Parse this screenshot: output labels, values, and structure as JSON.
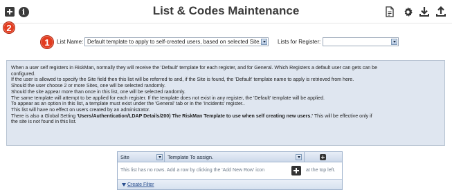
{
  "header": {
    "title": "List & Codes Maintenance",
    "icons": [
      "plus-square-icon",
      "info-icon",
      "document-icon",
      "gear-icon",
      "download-icon",
      "upload-icon"
    ]
  },
  "badges": {
    "one": "1",
    "two": "2"
  },
  "list_selector": {
    "list_name_label": "List Name:",
    "list_name_value": "Default template to apply to self-created users, based on selected Site.",
    "lists_for_register_label": "Lists for Register:",
    "lists_for_register_value": ""
  },
  "info": {
    "lines": [
      "When a user self registers in RiskMan, normally they will receive the 'Default' template for each register, and for General. Which Registers a default user can gets can be",
      "configured.",
      "If the user is allowed to specify the Site field then this list will be referred to and, if the Site is found, the 'Default' template name to apply is retrieved from here.",
      "Should the user choose 2 or more Sites, one will be selected randomly.",
      "Should the site appear more than once in this list, one will be selected randomly.",
      "The same template will attempt to be applied for each register. If the template does not exist in any register, the 'Default' template will be applied.",
      "To appear as an option in this list, a template must exist under the 'General' tab or in the 'Incidents' register..",
      "This list will have no effect on users created by an administrator."
    ],
    "global_prefix": "There is also a Global Setting ",
    "global_setting": "'Users/Authentication/LDAP Details/200) The RiskMan Template to use when self creating new users.'",
    "global_suffix": " This will be effective only if",
    "global_last": "the site is not found in this list."
  },
  "grid": {
    "columns": [
      "Site",
      "Template To assign."
    ],
    "empty_text": "This list has no rows. Add a row by clicking the 'Add New Row' icon",
    "empty_text_after": "at the top left.",
    "footer_link": "Create Filter"
  },
  "colors": {
    "badge": "#e23c20",
    "panel_bg": "#dfe6f0",
    "link": "#2a4f8f"
  }
}
